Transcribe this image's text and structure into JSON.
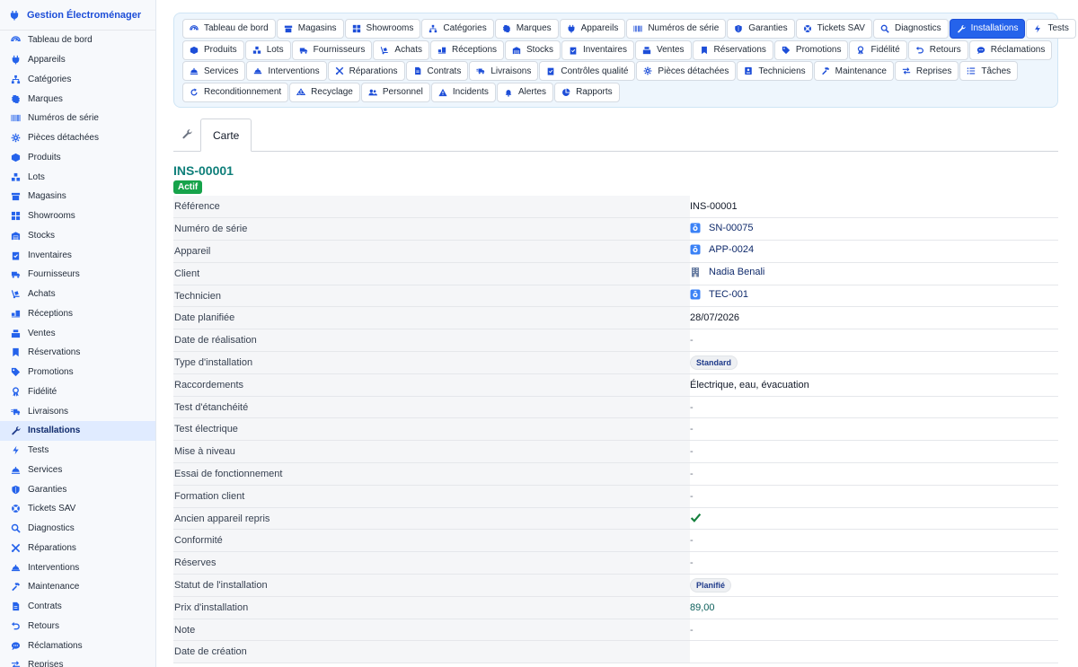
{
  "app": {
    "title": "Gestion Électroménager"
  },
  "sidebar": {
    "items": [
      {
        "label": "Tableau de bord",
        "icon": "dashboard-icon"
      },
      {
        "label": "Appareils",
        "icon": "plug-icon"
      },
      {
        "label": "Catégories",
        "icon": "sitemap-icon"
      },
      {
        "label": "Marques",
        "icon": "badge-icon"
      },
      {
        "label": "Numéros de série",
        "icon": "barcode-icon"
      },
      {
        "label": "Pièces détachées",
        "icon": "gear-icon"
      },
      {
        "label": "Produits",
        "icon": "box-icon"
      },
      {
        "label": "Lots",
        "icon": "boxes-icon"
      },
      {
        "label": "Magasins",
        "icon": "store-icon"
      },
      {
        "label": "Showrooms",
        "icon": "grid-icon"
      },
      {
        "label": "Stocks",
        "icon": "warehouse-icon"
      },
      {
        "label": "Inventaires",
        "icon": "clipboard-check-icon"
      },
      {
        "label": "Fournisseurs",
        "icon": "truck-icon"
      },
      {
        "label": "Achats",
        "icon": "dolly-icon"
      },
      {
        "label": "Réceptions",
        "icon": "truck-loading-icon"
      },
      {
        "label": "Ventes",
        "icon": "cash-register-icon"
      },
      {
        "label": "Réservations",
        "icon": "bookmark-icon"
      },
      {
        "label": "Promotions",
        "icon": "tags-icon"
      },
      {
        "label": "Fidélité",
        "icon": "award-icon"
      },
      {
        "label": "Livraisons",
        "icon": "shipping-fast-icon"
      },
      {
        "label": "Installations",
        "icon": "wrench-icon"
      },
      {
        "label": "Tests",
        "icon": "bolt-icon"
      },
      {
        "label": "Services",
        "icon": "concierge-icon"
      },
      {
        "label": "Garanties",
        "icon": "shield-icon"
      },
      {
        "label": "Tickets SAV",
        "icon": "lifebuoy-icon"
      },
      {
        "label": "Diagnostics",
        "icon": "search-icon"
      },
      {
        "label": "Réparations",
        "icon": "tools-icon"
      },
      {
        "label": "Interventions",
        "icon": "hard-hat-icon"
      },
      {
        "label": "Maintenance",
        "icon": "hammer-icon"
      },
      {
        "label": "Contrats",
        "icon": "file-contract-icon"
      },
      {
        "label": "Retours",
        "icon": "undo-icon"
      },
      {
        "label": "Réclamations",
        "icon": "comment-icon"
      },
      {
        "label": "Reprises",
        "icon": "exchange-icon"
      }
    ],
    "active_index": 20
  },
  "nav": {
    "rows": [
      [
        "Tableau de bord",
        "Magasins",
        "Showrooms",
        "Catégories",
        "Marques",
        "Appareils",
        "Numéros de série",
        "Garanties",
        "Tickets SAV",
        "Diagnostics",
        "Installations",
        "Tests"
      ],
      [
        "Produits",
        "Lots",
        "Fournisseurs",
        "Achats",
        "Réceptions",
        "Stocks",
        "Inventaires",
        "Ventes",
        "Réservations",
        "Promotions",
        "Fidélité",
        "Retours",
        "Réclamations"
      ],
      [
        "Services",
        "Interventions",
        "Réparations",
        "Contrats",
        "Livraisons",
        "Contrôles qualité",
        "Pièces détachées",
        "Techniciens",
        "Maintenance",
        "Reprises",
        "Tâches"
      ],
      [
        "Reconditionnement",
        "Recyclage",
        "Personnel",
        "Incidents",
        "Alertes",
        "Rapports"
      ]
    ],
    "active_label": "Installations"
  },
  "tabs": {
    "card_label": "Carte"
  },
  "record": {
    "title": "INS-00001",
    "status_badge": "Actif",
    "fields": [
      {
        "label": "Référence",
        "value": "INS-00001",
        "kind": "text"
      },
      {
        "label": "Numéro de série",
        "value": "SN-00075",
        "kind": "link",
        "icon": "record-icon"
      },
      {
        "label": "Appareil",
        "value": "APP-0024",
        "kind": "link",
        "icon": "record-icon"
      },
      {
        "label": "Client",
        "value": "Nadia Benali",
        "kind": "link",
        "icon": "building-icon"
      },
      {
        "label": "Technicien",
        "value": "TEC-001",
        "kind": "link",
        "icon": "record-icon"
      },
      {
        "label": "Date planifiée",
        "value": "28/07/2026",
        "kind": "text"
      },
      {
        "label": "Date de réalisation",
        "value": "-",
        "kind": "dash"
      },
      {
        "label": "Type d'installation",
        "value": "Standard",
        "kind": "pill"
      },
      {
        "label": "Raccordements",
        "value": "Électrique, eau, évacuation",
        "kind": "text"
      },
      {
        "label": "Test d'étanchéité",
        "value": "-",
        "kind": "dash"
      },
      {
        "label": "Test électrique",
        "value": "-",
        "kind": "dash"
      },
      {
        "label": "Mise à niveau",
        "value": "-",
        "kind": "dash"
      },
      {
        "label": "Essai de fonctionnement",
        "value": "-",
        "kind": "dash"
      },
      {
        "label": "Formation client",
        "value": "-",
        "kind": "dash"
      },
      {
        "label": "Ancien appareil repris",
        "value": "",
        "kind": "check"
      },
      {
        "label": "Conformité",
        "value": "-",
        "kind": "dash"
      },
      {
        "label": "Réserves",
        "value": "-",
        "kind": "dash"
      },
      {
        "label": "Statut de l'installation",
        "value": "Planifié",
        "kind": "pill"
      },
      {
        "label": "Prix d'installation",
        "value": "89,00",
        "kind": "price"
      },
      {
        "label": "Note",
        "value": "-",
        "kind": "dash"
      },
      {
        "label": "Date de création",
        "value": "",
        "kind": "text"
      }
    ]
  },
  "colors": {
    "accent": "#2563eb",
    "title_teal": "#0f7f7a",
    "badge_green": "#16a34a",
    "check_green": "#15803d"
  }
}
